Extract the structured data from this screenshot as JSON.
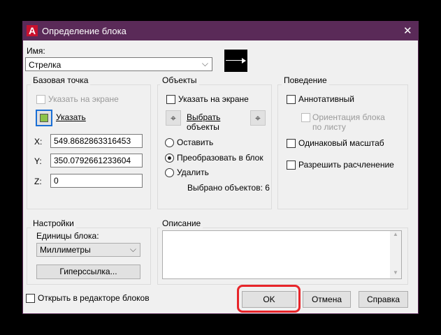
{
  "window": {
    "title": "Определение блока",
    "close": "✕"
  },
  "name": {
    "label": "Имя:",
    "value": "Стрелка"
  },
  "base_point": {
    "legend": "Базовая точка",
    "specify_on_screen": "Указать на экране",
    "pick": "Указать",
    "x_label": "X:",
    "x": "549.8682863316453",
    "y_label": "Y:",
    "y": "350.0792661233604",
    "z_label": "Z:",
    "z": "0"
  },
  "objects": {
    "legend": "Объекты",
    "specify_on_screen": "Указать на экране",
    "select_line1": "Выбрать",
    "select_line2": "объекты",
    "retain": "Оставить",
    "convert": "Преобразовать в блок",
    "delete": "Удалить",
    "selected_count": "Выбрано объектов: 6"
  },
  "behavior": {
    "legend": "Поведение",
    "annotative": "Аннотативный",
    "orient_line1": "Ориентация блока",
    "orient_line2": "по листу",
    "uniform_scale": "Одинаковый масштаб",
    "allow_explode": "Разрешить расчленение"
  },
  "settings": {
    "legend": "Настройки",
    "units_label": "Единицы блока:",
    "units_value": "Миллиметры",
    "hyperlink": "Гиперссылка..."
  },
  "description": {
    "legend": "Описание",
    "value": ""
  },
  "footer": {
    "open_in_editor": "Открыть в редакторе блоков",
    "ok": "OK",
    "cancel": "Отмена",
    "help": "Справка"
  },
  "colors": {
    "title_bar": "#5a2a58",
    "highlight": "#e8252a"
  }
}
